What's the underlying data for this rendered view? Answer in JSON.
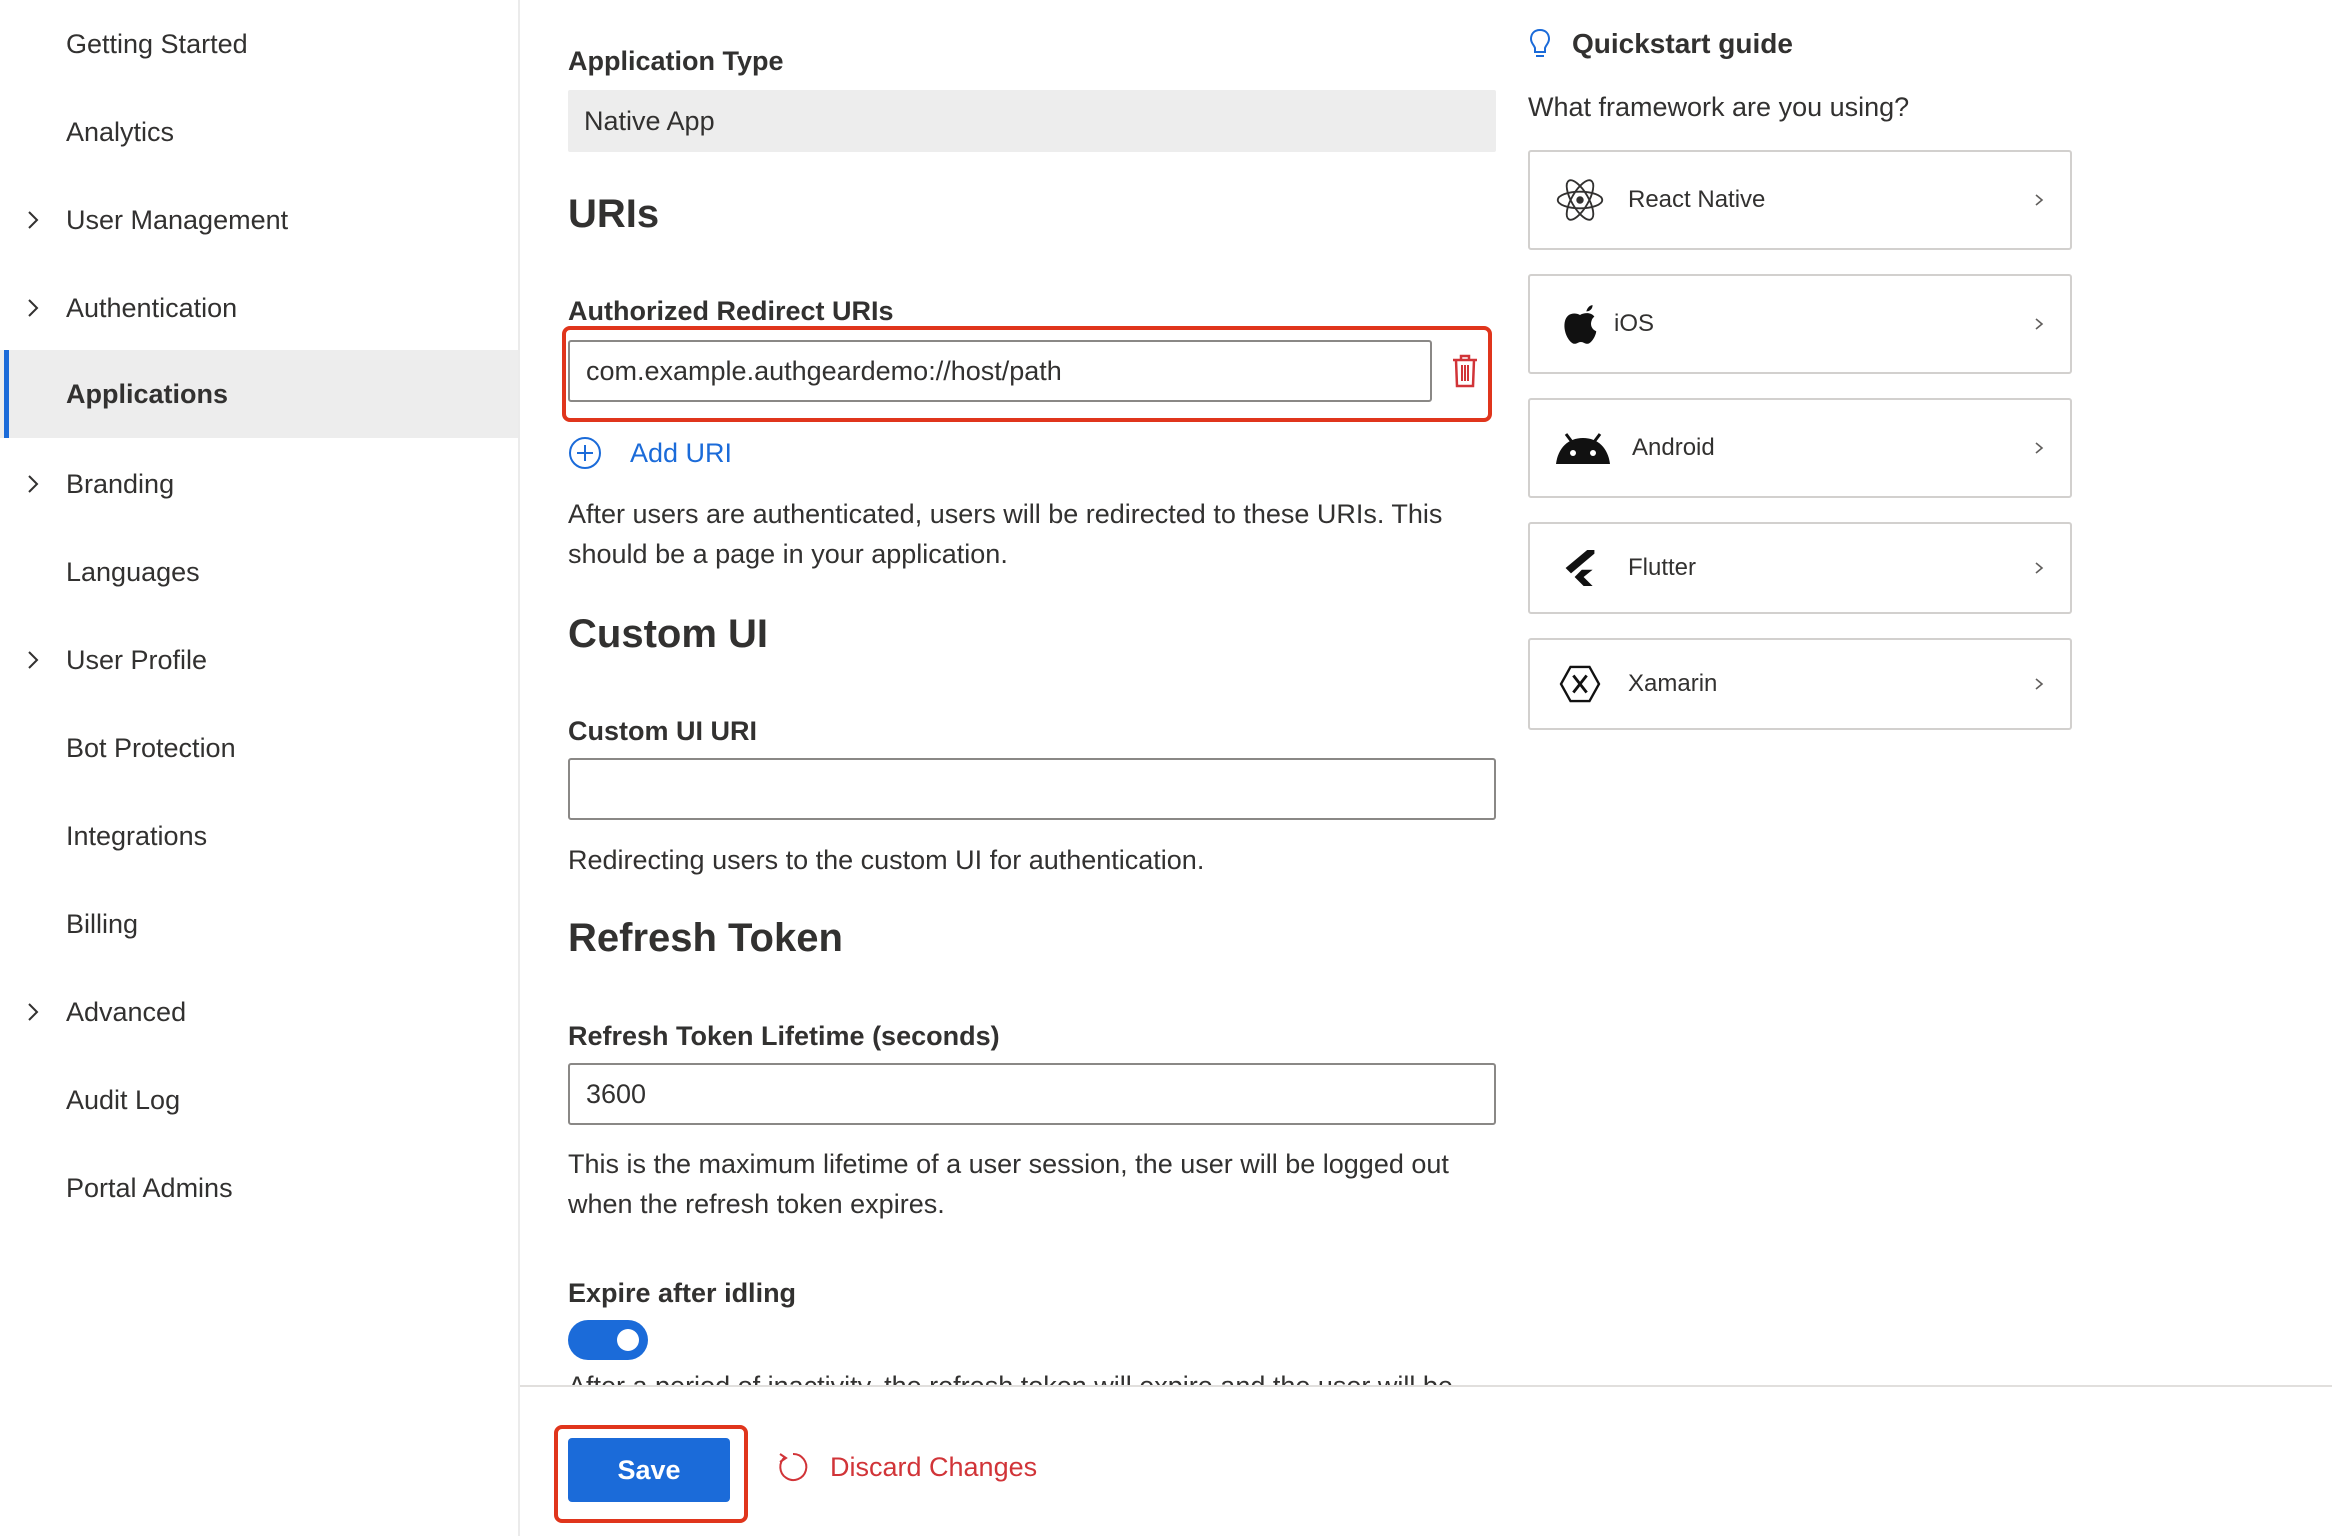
{
  "sidebar": {
    "items": [
      {
        "label": "Getting Started",
        "expandable": false,
        "active": false
      },
      {
        "label": "Analytics",
        "expandable": false,
        "active": false
      },
      {
        "label": "User Management",
        "expandable": true,
        "active": false
      },
      {
        "label": "Authentication",
        "expandable": true,
        "active": false
      },
      {
        "label": "Applications",
        "expandable": false,
        "active": true
      },
      {
        "label": "Branding",
        "expandable": true,
        "active": false
      },
      {
        "label": "Languages",
        "expandable": false,
        "active": false
      },
      {
        "label": "User Profile",
        "expandable": true,
        "active": false
      },
      {
        "label": "Bot Protection",
        "expandable": false,
        "active": false
      },
      {
        "label": "Integrations",
        "expandable": false,
        "active": false
      },
      {
        "label": "Billing",
        "expandable": false,
        "active": false
      },
      {
        "label": "Advanced",
        "expandable": true,
        "active": false
      },
      {
        "label": "Audit Log",
        "expandable": false,
        "active": false
      },
      {
        "label": "Portal Admins",
        "expandable": false,
        "active": false
      }
    ]
  },
  "form": {
    "app_type_label": "Application Type",
    "app_type_value": "Native App",
    "uris_title": "URIs",
    "redirect_label": "Authorized Redirect URIs",
    "redirect_value": "com.example.authgeardemo://host/path",
    "add_uri": "Add URI",
    "redirect_help": "After users are authenticated, users will be redirected to these URIs. This should be a page in your application.",
    "custom_ui_title": "Custom UI",
    "custom_ui_label": "Custom UI URI",
    "custom_ui_value": "",
    "custom_ui_help": "Redirecting users to the custom UI for authentication.",
    "refresh_title": "Refresh Token",
    "refresh_lifetime_label": "Refresh Token Lifetime (seconds)",
    "refresh_lifetime_value": "3600",
    "refresh_help": "This is the maximum lifetime of a user session, the user will be logged out when the refresh token expires.",
    "expire_idle_label": "Expire after idling",
    "expire_idle_on": true,
    "expire_idle_help": "After a period of inactivity, the refresh token will expire and the user will be"
  },
  "footer": {
    "save_label": "Save",
    "discard_label": "Discard Changes"
  },
  "quickstart": {
    "title": "Quickstart guide",
    "question": "What framework are you using?",
    "frameworks": [
      {
        "label": "React Native",
        "icon": "react-icon"
      },
      {
        "label": "iOS",
        "icon": "apple-icon"
      },
      {
        "label": "Android",
        "icon": "android-icon"
      },
      {
        "label": "Flutter",
        "icon": "flutter-icon"
      },
      {
        "label": "Xamarin",
        "icon": "xamarin-icon"
      }
    ]
  },
  "colors": {
    "accent": "#1b6bd9",
    "danger": "#d13438",
    "highlight": "#e0351c"
  }
}
